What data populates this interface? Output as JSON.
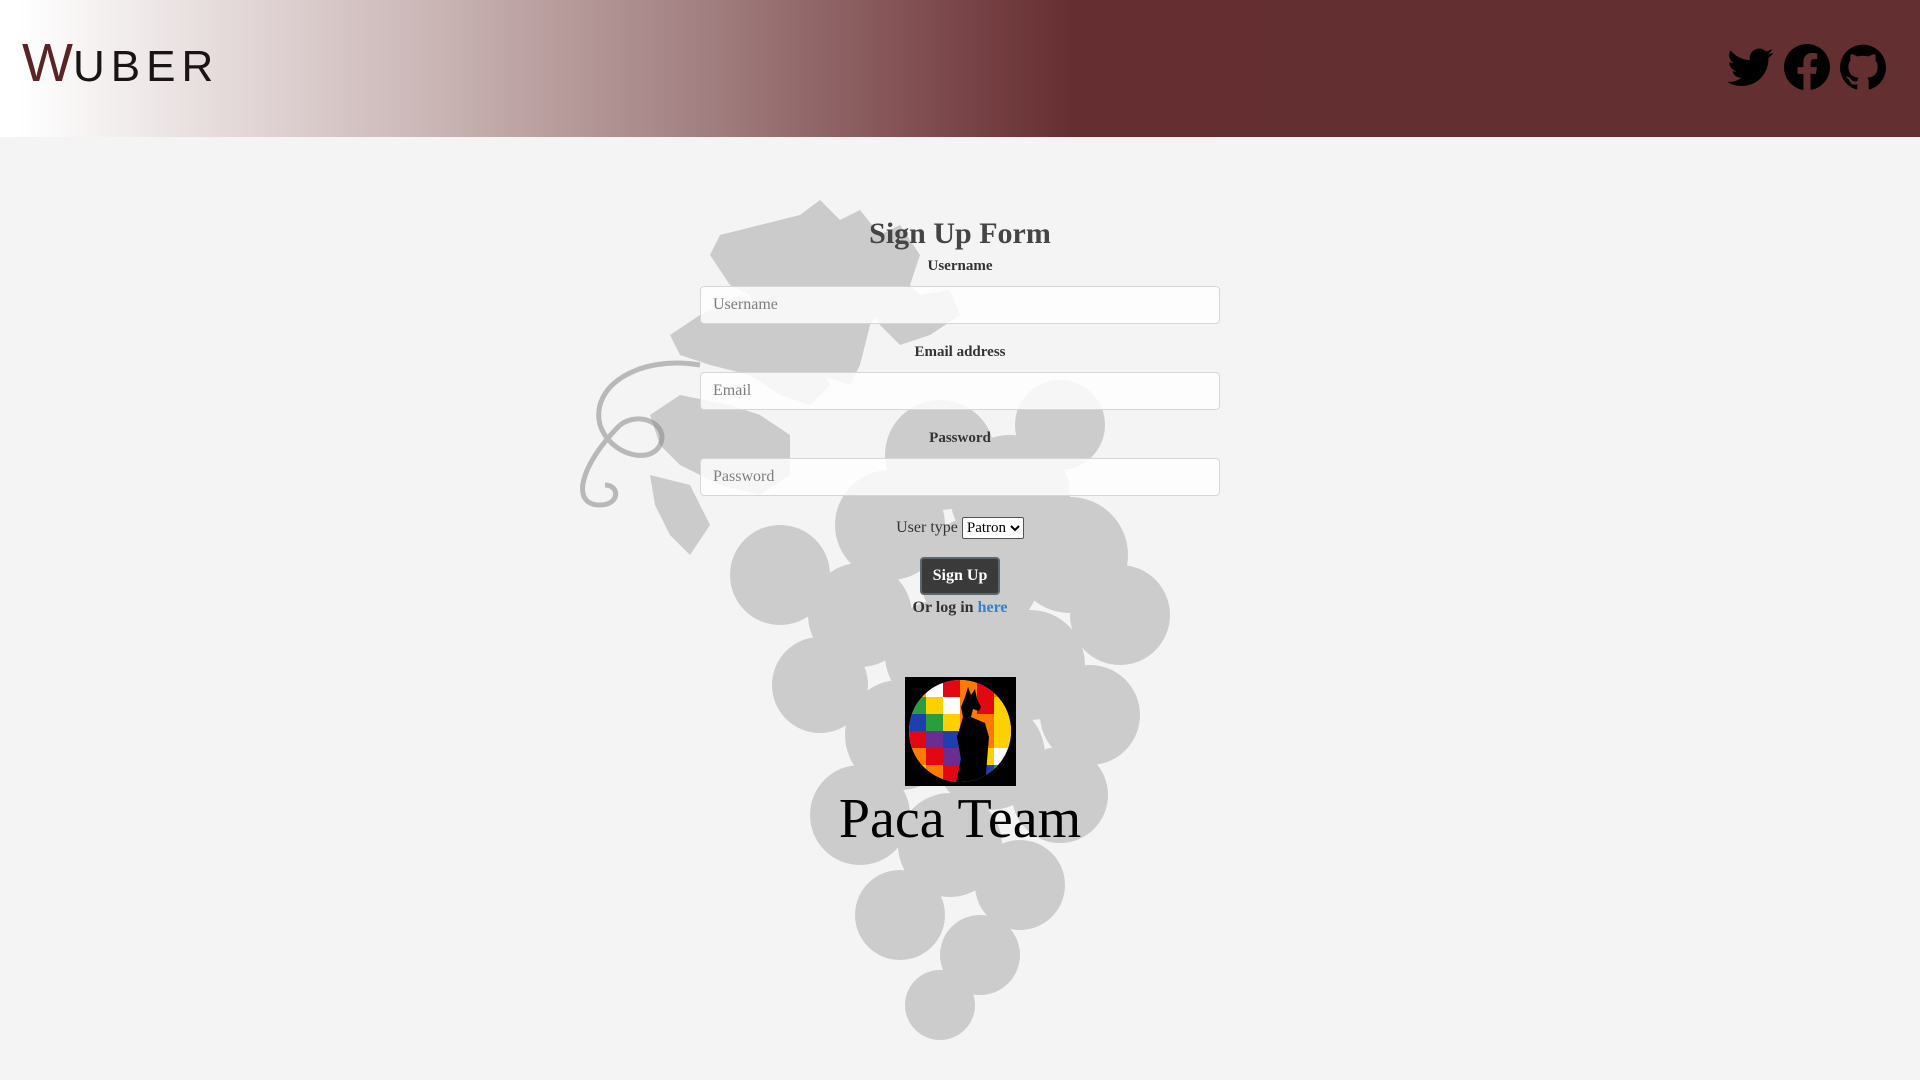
{
  "header": {
    "logo_first_letter": "W",
    "logo_rest": "UBER",
    "social_icons": [
      "twitter-icon",
      "facebook-icon",
      "github-icon"
    ]
  },
  "colors": {
    "header_dark": "#632f30",
    "page_background": "#f4f4f4",
    "button_background": "#3a3a3a",
    "link": "#2f83d6"
  },
  "form": {
    "title": "Sign Up Form",
    "username_label": "Username",
    "username_placeholder": "Username",
    "username_value": "",
    "email_label": "Email address",
    "email_placeholder": "Email",
    "email_value": "",
    "password_label": "Password",
    "password_placeholder": "Password",
    "password_value": "",
    "user_type_label": "User type",
    "user_type_selected": "Patron",
    "submit_label": "Sign Up",
    "login_prefix": "Or log in",
    "login_link": "here"
  },
  "footer": {
    "team_name": "Paca Team"
  }
}
